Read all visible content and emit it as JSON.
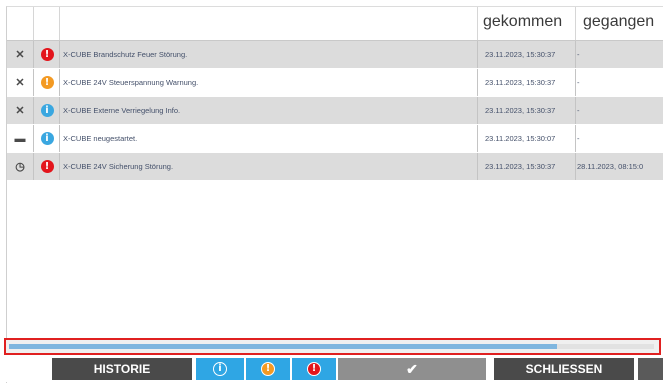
{
  "table": {
    "columns": {
      "came": "gekommen",
      "went": "gegangen"
    },
    "rows": [
      {
        "action_icon": "close-icon",
        "action_glyph": "✕",
        "severity": "error",
        "severity_glyph": "!",
        "message": "X-CUBE Brandschutz Feuer Störung.",
        "came": "23.11.2023, 15:30:37",
        "went": "-"
      },
      {
        "action_icon": "close-icon",
        "action_glyph": "✕",
        "severity": "warning",
        "severity_glyph": "!",
        "message": "X-CUBE 24V Steuerspannung Warnung.",
        "came": "23.11.2023, 15:30:37",
        "went": "-"
      },
      {
        "action_icon": "close-icon",
        "action_glyph": "✕",
        "severity": "info",
        "severity_glyph": "i",
        "message": "X-CUBE Externe Verriegelung Info.",
        "came": "23.11.2023, 15:30:37",
        "went": "-"
      },
      {
        "action_icon": "comment-icon",
        "action_glyph": "▬",
        "severity": "info",
        "severity_glyph": "i",
        "message": "X-CUBE neugestartet.",
        "came": "23.11.2023, 15:30:07",
        "went": "-"
      },
      {
        "action_icon": "clock-icon",
        "action_glyph": "◷",
        "severity": "error",
        "severity_glyph": "!",
        "message": "X-CUBE 24V Sicherung Störung.",
        "came": "23.11.2023, 15:30:37",
        "went": "28.11.2023, 08:15:0"
      }
    ]
  },
  "scrollbar": {
    "position_fraction": 0.85
  },
  "toolbar": {
    "history_label": "HISTORIE",
    "filter_info_glyph": "i",
    "filter_warning_glyph": "!",
    "filter_error_glyph": "!",
    "confirm_glyph": "✔",
    "close_label": "SCHLIESSEN"
  },
  "colors": {
    "error": "#e3151c",
    "warning": "#f39a23",
    "info": "#3aa7e0",
    "highlight_border": "#e02020"
  }
}
